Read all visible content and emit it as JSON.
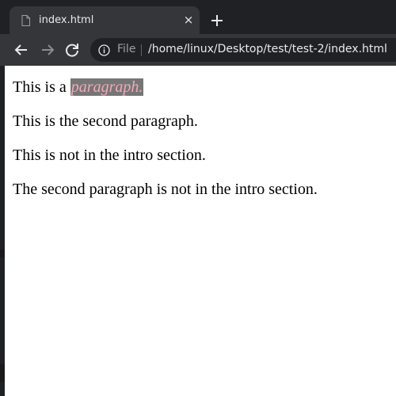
{
  "browser": {
    "tab": {
      "title": "index.html",
      "close_glyph": "×",
      "favicon_icon": "file-icon"
    },
    "new_tab_icon": "plus-icon",
    "toolbar": {
      "back_icon": "arrow-left-icon",
      "forward_icon": "arrow-right-icon",
      "reload_icon": "reload-icon",
      "info_icon": "info-icon",
      "scheme_label": "File",
      "url": "/home/linux/Desktop/test/test-2/index.html"
    },
    "colors": {
      "frame": "#202124",
      "toolbar": "#35363a",
      "text": "#e8eaed",
      "highlight_bg": "#767676",
      "highlight_text": "#f2a9b8"
    }
  },
  "page": {
    "p1": {
      "prefix": "This is a ",
      "highlighted": "paragraph."
    },
    "p2": "This is the second paragraph.",
    "p3": "This is not in the intro section.",
    "p4": "The second paragraph is not in the intro section."
  }
}
